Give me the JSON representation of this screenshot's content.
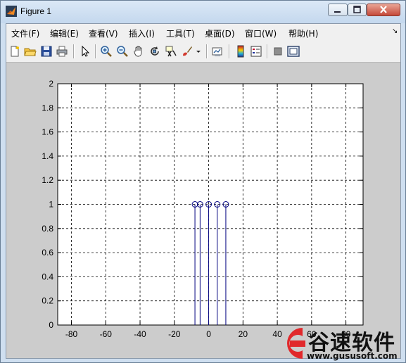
{
  "window": {
    "title": "Figure 1",
    "controls": {
      "minimize": "minimize",
      "maximize": "maximize",
      "close": "close"
    }
  },
  "menu": {
    "items": [
      {
        "label": "文件(F)"
      },
      {
        "label": "编辑(E)"
      },
      {
        "label": "查看(V)"
      },
      {
        "label": "插入(I)"
      },
      {
        "label": "工具(T)"
      },
      {
        "label": "桌面(D)"
      },
      {
        "label": "窗口(W)"
      },
      {
        "label": "帮助(H)"
      }
    ],
    "overflow_arrow": "↘"
  },
  "toolbar": {
    "icons": [
      "new-figure-icon",
      "open-file-icon",
      "save-icon",
      "print-icon",
      "pointer-icon",
      "zoom-in-icon",
      "zoom-out-icon",
      "pan-hand-icon",
      "rotate-3d-icon",
      "data-cursor-icon",
      "brush-icon",
      "brush-dropdown-icon",
      "link-plot-icon",
      "colorbar-icon",
      "legend-icon",
      "hide-plot-tools-icon",
      "show-plot-tools-icon"
    ]
  },
  "chart_data": {
    "type": "scatter",
    "subtype": "stem",
    "title": "",
    "xlabel": "",
    "ylabel": "",
    "xlim": [
      -88,
      90
    ],
    "ylim": [
      0,
      2
    ],
    "xticks": [
      "-80",
      "-60",
      "-40",
      "-20",
      "0",
      "20",
      "40",
      "60",
      "80"
    ],
    "yticks": [
      "0",
      "0.2",
      "0.4",
      "0.6",
      "0.8",
      "1",
      "1.2",
      "1.4",
      "1.6",
      "1.8",
      "2"
    ],
    "grid": true,
    "grid_style": "dashed",
    "series": [
      {
        "color": "#00007f",
        "marker": "circle",
        "x": [
          -8,
          -5,
          0,
          5,
          10
        ],
        "y": [
          1,
          1,
          1,
          1,
          1
        ]
      }
    ]
  },
  "watermark": {
    "text": "谷速软件",
    "url": "www.gususoft.com",
    "color": "#e1282b"
  }
}
